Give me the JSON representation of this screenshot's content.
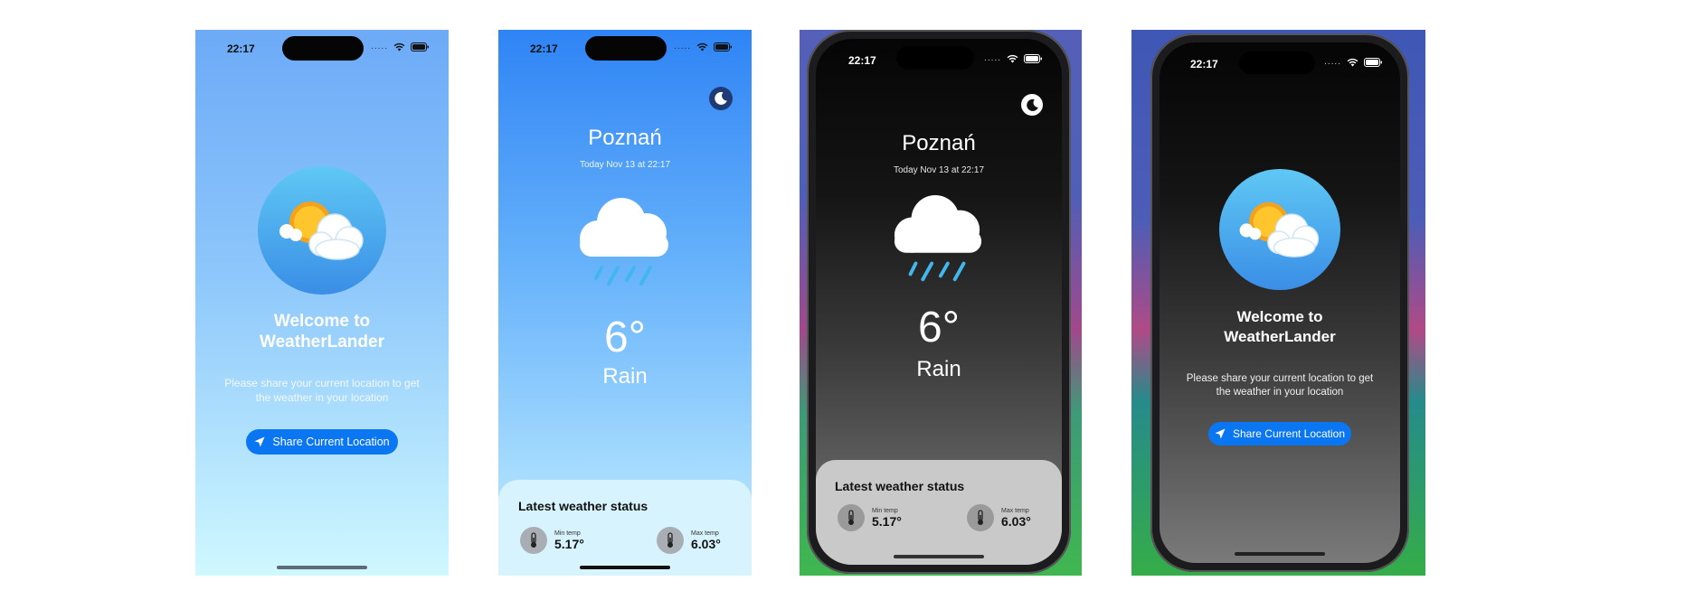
{
  "status": {
    "time": "22:17",
    "dots": "....."
  },
  "welcome": {
    "title_line1": "Welcome to",
    "title_line2": "WeatherLander",
    "subtitle_line1": "Please share your current location to get",
    "subtitle_line2": "the weather in your location",
    "share_button": "Share Current Location"
  },
  "weather": {
    "city": "Poznań",
    "date": "Today Nov 13 at 22:17",
    "temperature": "6°",
    "condition": "Rain",
    "status_title": "Latest weather status",
    "min_label": "Min temp",
    "min_value": "5.17°",
    "max_label": "Max temp",
    "max_value": "6.03°"
  },
  "icons": [
    "moon-icon",
    "cloud-rain-icon",
    "sun-cloud-icon",
    "location-arrow-icon",
    "thermometer-icon",
    "wifi-icon",
    "battery-icon"
  ],
  "colors": {
    "accent": "#0a76f2",
    "dark_bg": "#0a0a0a"
  }
}
